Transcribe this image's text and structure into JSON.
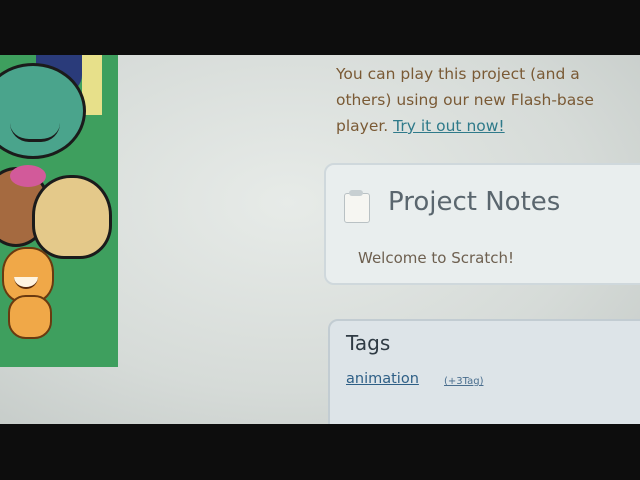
{
  "flash_note": {
    "line1": "You can play this project (and a",
    "line2": "others) using our new Flash-base",
    "line3_prefix": "player. ",
    "try_link": "Try it out now!"
  },
  "project_notes": {
    "title": "Project Notes",
    "text": "Welcome to Scratch!"
  },
  "tags": {
    "title": "Tags",
    "items": [
      {
        "label": "animation",
        "count": "(+3Tag)"
      }
    ]
  }
}
